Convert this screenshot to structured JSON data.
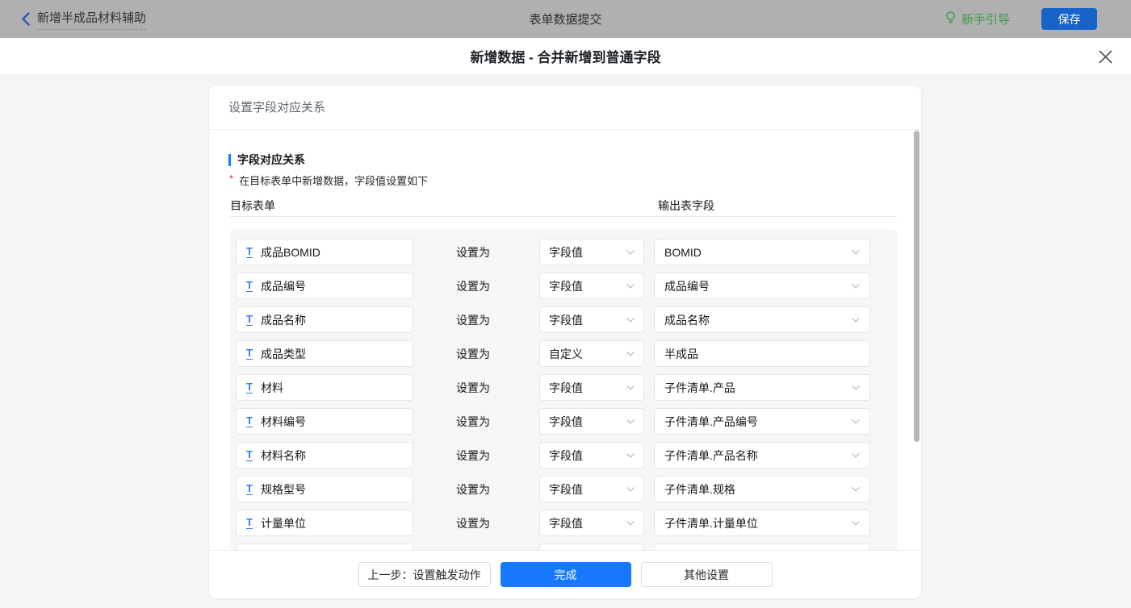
{
  "topbar": {
    "back_label": "新增半成品材料辅助",
    "center_title": "表单数据提交",
    "guide_label": "新手引导",
    "save_label": "保存"
  },
  "modal": {
    "title": "新增数据 - 合并新增到普通字段"
  },
  "card": {
    "header": "设置字段对应关系",
    "section_title": "字段对应关系",
    "required_marker": "*",
    "note": "在目标表单中新增数据，字段值设置如下",
    "col_left": "目标表单",
    "col_right": "输出表字段",
    "action_label": "设置为"
  },
  "rows": [
    {
      "target": "成品BOMID",
      "mode": "字段值",
      "output": "BOMID",
      "output_type": "select"
    },
    {
      "target": "成品编号",
      "mode": "字段值",
      "output": "成品编号",
      "output_type": "select"
    },
    {
      "target": "成品名称",
      "mode": "字段值",
      "output": "成品名称",
      "output_type": "select"
    },
    {
      "target": "成品类型",
      "mode": "自定义",
      "output": "半成品",
      "output_type": "input"
    },
    {
      "target": "材料",
      "mode": "字段值",
      "output": "子件清单.产品",
      "output_type": "select"
    },
    {
      "target": "材料编号",
      "mode": "字段值",
      "output": "子件清单.产品编号",
      "output_type": "select"
    },
    {
      "target": "材料名称",
      "mode": "字段值",
      "output": "子件清单.产品名称",
      "output_type": "select"
    },
    {
      "target": "规格型号",
      "mode": "字段值",
      "output": "子件清单.规格",
      "output_type": "select"
    },
    {
      "target": "计量单位",
      "mode": "字段值",
      "output": "子件清单.计量单位",
      "output_type": "select"
    },
    {
      "target": "",
      "mode": "",
      "output": "",
      "output_type": "input",
      "clipped": true
    }
  ],
  "footer": {
    "prev_label": "上一步：设置触发动作",
    "finish_label": "完成",
    "other_label": "其他设置"
  },
  "colors": {
    "accent_blue": "#1677ff",
    "save_blue": "#1763c8",
    "guide_green": "#3f9d45",
    "required_red": "#f5222d",
    "topbar_gray": "#b0b0b0"
  }
}
